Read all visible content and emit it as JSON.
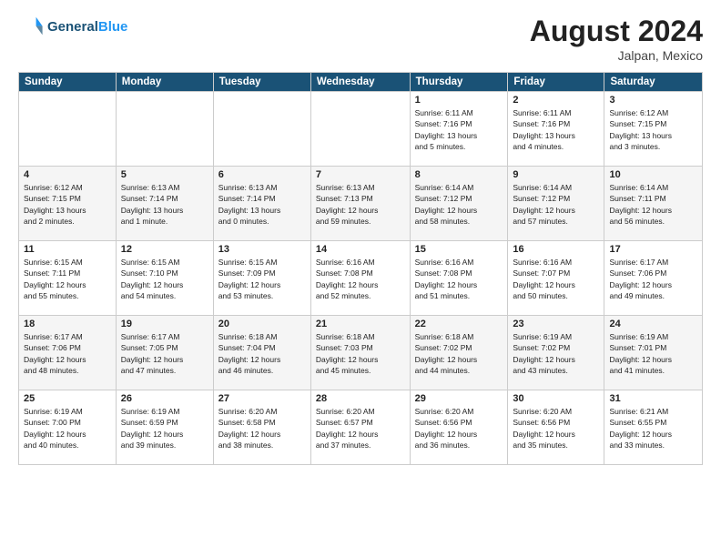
{
  "header": {
    "logo_line1": "General",
    "logo_line2": "Blue",
    "month_year": "August 2024",
    "location": "Jalpan, Mexico"
  },
  "days_of_week": [
    "Sunday",
    "Monday",
    "Tuesday",
    "Wednesday",
    "Thursday",
    "Friday",
    "Saturday"
  ],
  "weeks": [
    {
      "days": [
        {
          "num": "",
          "info": ""
        },
        {
          "num": "",
          "info": ""
        },
        {
          "num": "",
          "info": ""
        },
        {
          "num": "",
          "info": ""
        },
        {
          "num": "1",
          "info": "Sunrise: 6:11 AM\nSunset: 7:16 PM\nDaylight: 13 hours\nand 5 minutes."
        },
        {
          "num": "2",
          "info": "Sunrise: 6:11 AM\nSunset: 7:16 PM\nDaylight: 13 hours\nand 4 minutes."
        },
        {
          "num": "3",
          "info": "Sunrise: 6:12 AM\nSunset: 7:15 PM\nDaylight: 13 hours\nand 3 minutes."
        }
      ]
    },
    {
      "days": [
        {
          "num": "4",
          "info": "Sunrise: 6:12 AM\nSunset: 7:15 PM\nDaylight: 13 hours\nand 2 minutes."
        },
        {
          "num": "5",
          "info": "Sunrise: 6:13 AM\nSunset: 7:14 PM\nDaylight: 13 hours\nand 1 minute."
        },
        {
          "num": "6",
          "info": "Sunrise: 6:13 AM\nSunset: 7:14 PM\nDaylight: 13 hours\nand 0 minutes."
        },
        {
          "num": "7",
          "info": "Sunrise: 6:13 AM\nSunset: 7:13 PM\nDaylight: 12 hours\nand 59 minutes."
        },
        {
          "num": "8",
          "info": "Sunrise: 6:14 AM\nSunset: 7:12 PM\nDaylight: 12 hours\nand 58 minutes."
        },
        {
          "num": "9",
          "info": "Sunrise: 6:14 AM\nSunset: 7:12 PM\nDaylight: 12 hours\nand 57 minutes."
        },
        {
          "num": "10",
          "info": "Sunrise: 6:14 AM\nSunset: 7:11 PM\nDaylight: 12 hours\nand 56 minutes."
        }
      ]
    },
    {
      "days": [
        {
          "num": "11",
          "info": "Sunrise: 6:15 AM\nSunset: 7:11 PM\nDaylight: 12 hours\nand 55 minutes."
        },
        {
          "num": "12",
          "info": "Sunrise: 6:15 AM\nSunset: 7:10 PM\nDaylight: 12 hours\nand 54 minutes."
        },
        {
          "num": "13",
          "info": "Sunrise: 6:15 AM\nSunset: 7:09 PM\nDaylight: 12 hours\nand 53 minutes."
        },
        {
          "num": "14",
          "info": "Sunrise: 6:16 AM\nSunset: 7:08 PM\nDaylight: 12 hours\nand 52 minutes."
        },
        {
          "num": "15",
          "info": "Sunrise: 6:16 AM\nSunset: 7:08 PM\nDaylight: 12 hours\nand 51 minutes."
        },
        {
          "num": "16",
          "info": "Sunrise: 6:16 AM\nSunset: 7:07 PM\nDaylight: 12 hours\nand 50 minutes."
        },
        {
          "num": "17",
          "info": "Sunrise: 6:17 AM\nSunset: 7:06 PM\nDaylight: 12 hours\nand 49 minutes."
        }
      ]
    },
    {
      "days": [
        {
          "num": "18",
          "info": "Sunrise: 6:17 AM\nSunset: 7:06 PM\nDaylight: 12 hours\nand 48 minutes."
        },
        {
          "num": "19",
          "info": "Sunrise: 6:17 AM\nSunset: 7:05 PM\nDaylight: 12 hours\nand 47 minutes."
        },
        {
          "num": "20",
          "info": "Sunrise: 6:18 AM\nSunset: 7:04 PM\nDaylight: 12 hours\nand 46 minutes."
        },
        {
          "num": "21",
          "info": "Sunrise: 6:18 AM\nSunset: 7:03 PM\nDaylight: 12 hours\nand 45 minutes."
        },
        {
          "num": "22",
          "info": "Sunrise: 6:18 AM\nSunset: 7:02 PM\nDaylight: 12 hours\nand 44 minutes."
        },
        {
          "num": "23",
          "info": "Sunrise: 6:19 AM\nSunset: 7:02 PM\nDaylight: 12 hours\nand 43 minutes."
        },
        {
          "num": "24",
          "info": "Sunrise: 6:19 AM\nSunset: 7:01 PM\nDaylight: 12 hours\nand 41 minutes."
        }
      ]
    },
    {
      "days": [
        {
          "num": "25",
          "info": "Sunrise: 6:19 AM\nSunset: 7:00 PM\nDaylight: 12 hours\nand 40 minutes."
        },
        {
          "num": "26",
          "info": "Sunrise: 6:19 AM\nSunset: 6:59 PM\nDaylight: 12 hours\nand 39 minutes."
        },
        {
          "num": "27",
          "info": "Sunrise: 6:20 AM\nSunset: 6:58 PM\nDaylight: 12 hours\nand 38 minutes."
        },
        {
          "num": "28",
          "info": "Sunrise: 6:20 AM\nSunset: 6:57 PM\nDaylight: 12 hours\nand 37 minutes."
        },
        {
          "num": "29",
          "info": "Sunrise: 6:20 AM\nSunset: 6:56 PM\nDaylight: 12 hours\nand 36 minutes."
        },
        {
          "num": "30",
          "info": "Sunrise: 6:20 AM\nSunset: 6:56 PM\nDaylight: 12 hours\nand 35 minutes."
        },
        {
          "num": "31",
          "info": "Sunrise: 6:21 AM\nSunset: 6:55 PM\nDaylight: 12 hours\nand 33 minutes."
        }
      ]
    }
  ]
}
